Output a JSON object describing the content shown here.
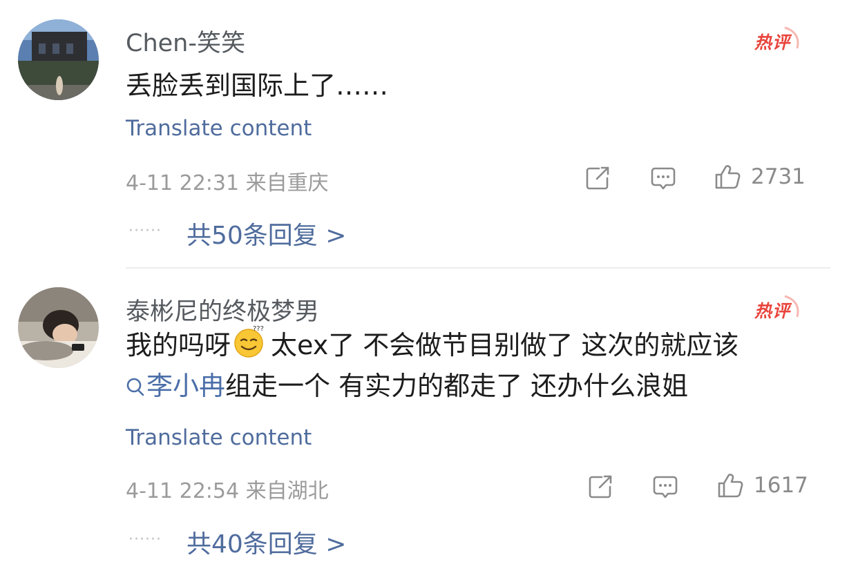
{
  "comments": [
    {
      "username": "Chen-笑笑",
      "hot_badge": "热评",
      "text_lines": [
        "丢脸丢到国际上了……"
      ],
      "translate": "Translate content",
      "meta": "4-11 22:31 来自重庆",
      "like_count": "2731",
      "replies": "共50条回复 >"
    },
    {
      "username": "泰彬尼的终极梦男",
      "hot_badge": "热评",
      "text_prefix": "我的吗呀",
      "text_line1_suffix": "太ex了 不会做节目别做了 这次的就应该",
      "mention": "李小冉",
      "text_line2_suffix": "组走一个 有实力的都走了 还办什么浪姐",
      "translate": "Translate content",
      "meta": "4-11 22:54 来自湖北",
      "like_count": "1617",
      "replies": "共40条回复 >"
    }
  ],
  "icons": {
    "share": "share-icon",
    "reply": "comment-icon",
    "like": "thumbs-up-icon",
    "emoji": "confused-smile-emoji",
    "mention": "search-icon",
    "dots": "ellipsis-icon"
  },
  "colors": {
    "link": "#4f6c9d",
    "hot": "#e8453c",
    "meta": "#9b9b9b"
  }
}
